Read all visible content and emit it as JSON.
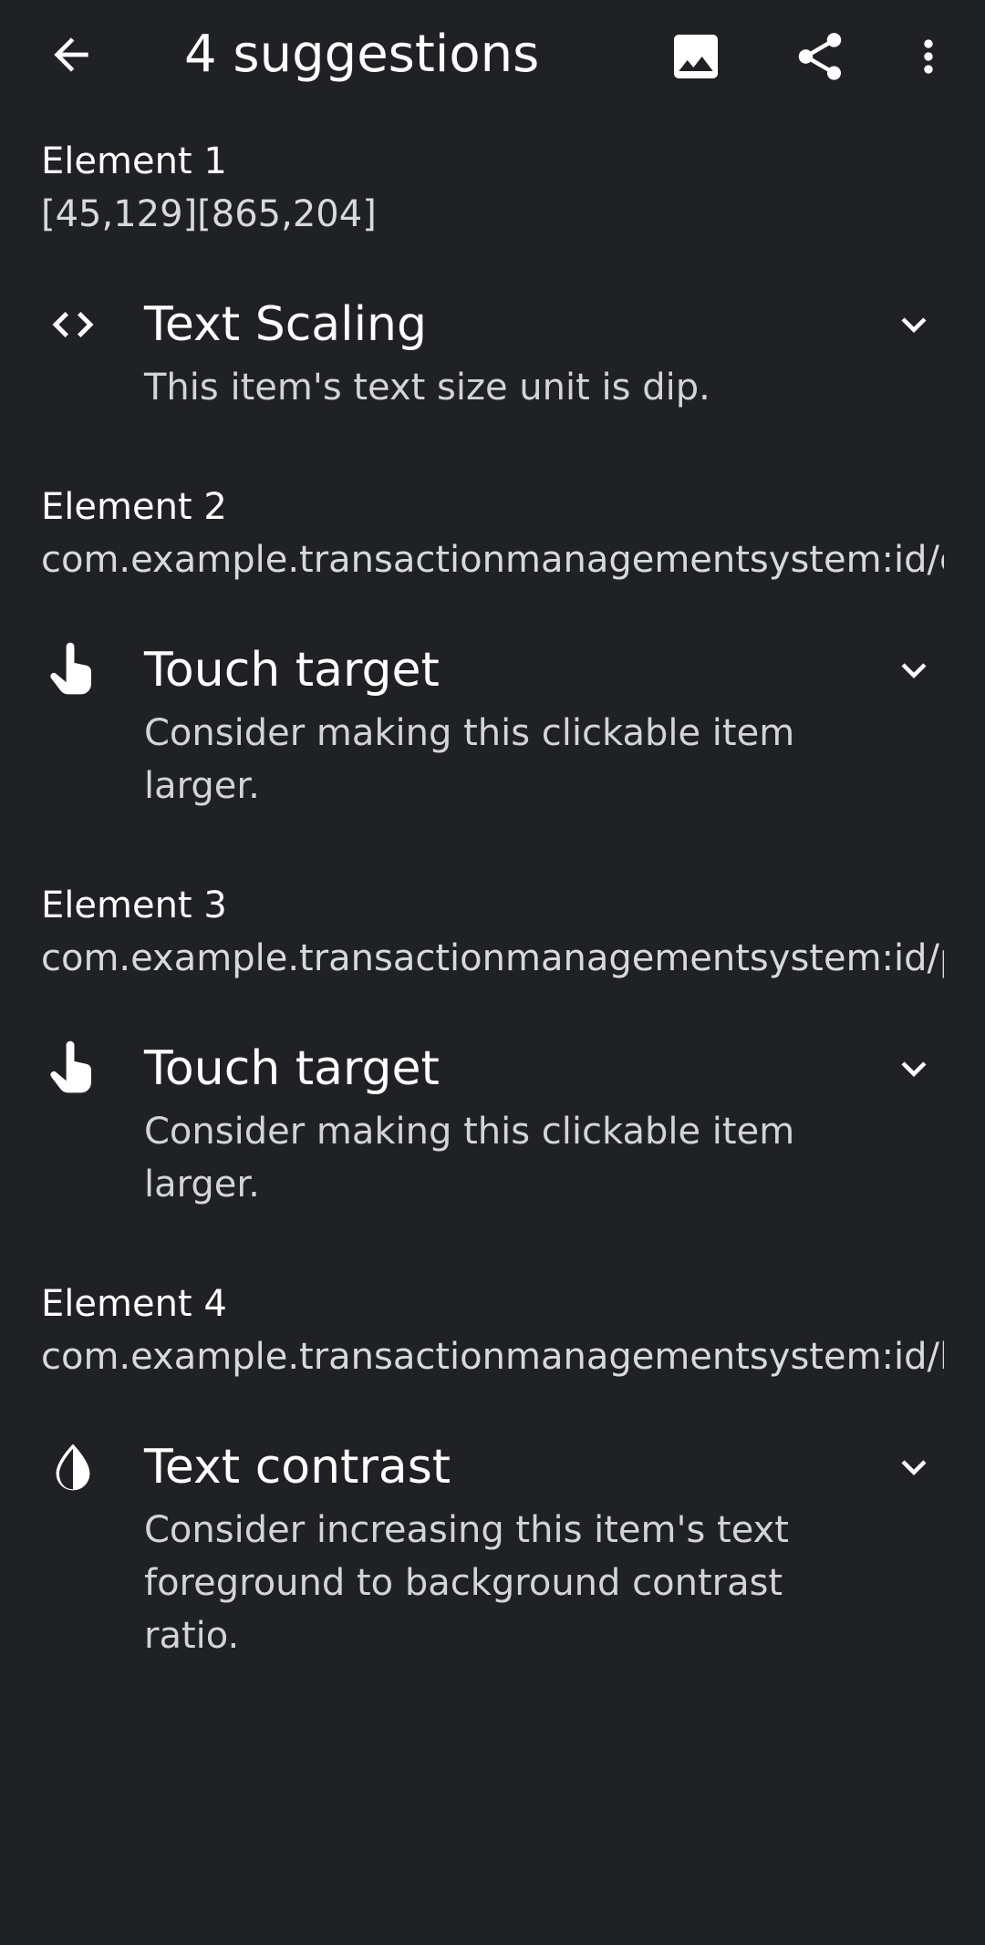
{
  "appbar": {
    "title": "4 suggestions",
    "icons": {
      "back": "back-arrow-icon",
      "image": "image-icon",
      "share": "share-icon",
      "more": "more-vert-icon"
    }
  },
  "elements": [
    {
      "name": "Element 1",
      "id": "[45,129][865,204]",
      "suggestion": {
        "icon": "code-brackets-icon",
        "title": "Text Scaling",
        "description": "This item's text size unit is dip."
      }
    },
    {
      "name": "Element 2",
      "id": "com.example.transactionmanagementsystem:id/e..",
      "suggestion": {
        "icon": "touch-hand-icon",
        "title": "Touch target",
        "description": "Consider making this clickable item larger."
      }
    },
    {
      "name": "Element 3",
      "id": "com.example.transactionmanagementsystem:id/p..",
      "suggestion": {
        "icon": "touch-hand-icon",
        "title": "Touch target",
        "description": "Consider making this clickable item larger."
      }
    },
    {
      "name": "Element 4",
      "id": "com.example.transactionmanagementsystem:id/lo..",
      "suggestion": {
        "icon": "contrast-icon",
        "title": "Text contrast",
        "description": "Consider increasing this item's text foreground to background contrast ratio."
      }
    }
  ],
  "colors": {
    "background": "#202124",
    "primary_text": "#ffffff",
    "secondary_text": "#d7d9dc"
  }
}
